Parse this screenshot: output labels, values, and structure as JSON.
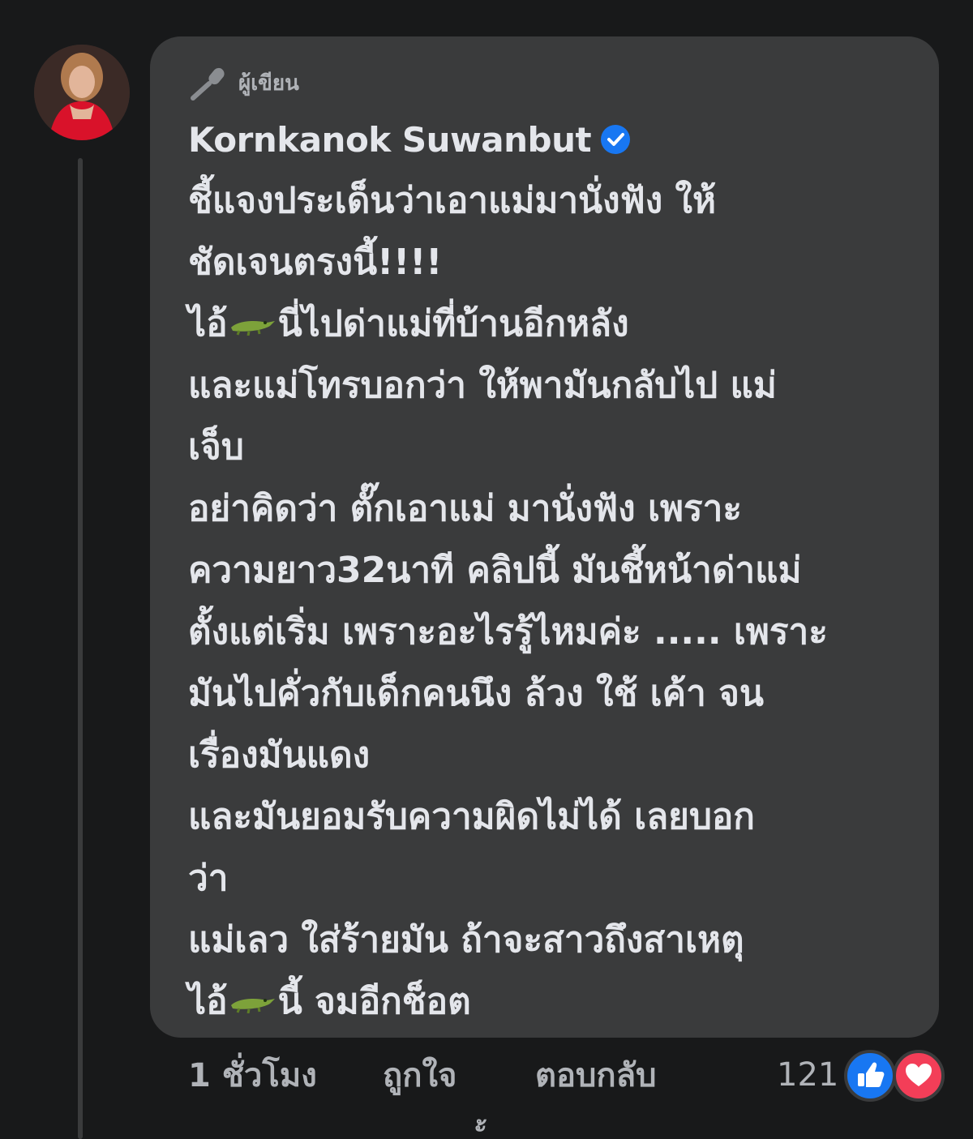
{
  "comment": {
    "author_badge": "ผู้เขียน",
    "author_name": "Kornkanok Suwanbut",
    "lines": [
      "ชี้แจงประเด็นว่าเอาแม่มานั่งฟัง ให้",
      "ชัดเจนตรงนี้!!!!",
      "ไอ้🐊นี่ไปด่าแม่ที่บ้านอีกหลัง",
      "และแม่โทรบอกว่า ให้พามันกลับไป แม่",
      "เจ็บ",
      "อย่าคิดว่า ตั๊กเอาแม่ มานั่งฟัง เพราะ",
      "ความยาว32นาที คลิปนี้ มันชี้หน้าด่าแม่",
      "ตั้งแต่เริ่ม เพราะอะไรรู้ไหมค่ะ ..... เพราะ",
      "มันไปคั่วกับเด็กคนนึง ล้วง ใช้ เค้า จน",
      "เรื่องมันแดง",
      "และมันยอมรับความผิดไม่ได้ เลยบอก",
      "ว่า",
      "แม่เลว ใส่ร้ายมัน ถ้าจะสาวถึงสาเหตุ",
      "ไอ้🐊นี้ จมอีกช็อต"
    ],
    "line_parts": {
      "l3_a": "ไอ้",
      "l3_b": "นี่ไปด่าแม่ที่บ้านอีกหลัง",
      "l14_a": "ไอ้",
      "l14_b": "นี้ จมอีกช็อต"
    }
  },
  "meta": {
    "time": "1 ชั่วโมง",
    "like": "ถูกใจ",
    "reply": "ตอบกลับ",
    "reaction_count": "121"
  },
  "colors": {
    "background": "#18191a",
    "bubble": "#3a3b3c",
    "text": "#e4e6eb",
    "secondary_text": "#b0b3b8",
    "like_blue": "#1877f2",
    "love_red": "#f33e58"
  },
  "icons": {
    "author_badge": "microphone-icon",
    "verified": "verified-badge-icon",
    "reactions": [
      "like-reaction-icon",
      "love-reaction-icon"
    ],
    "emoji": "crocodile-emoji"
  }
}
